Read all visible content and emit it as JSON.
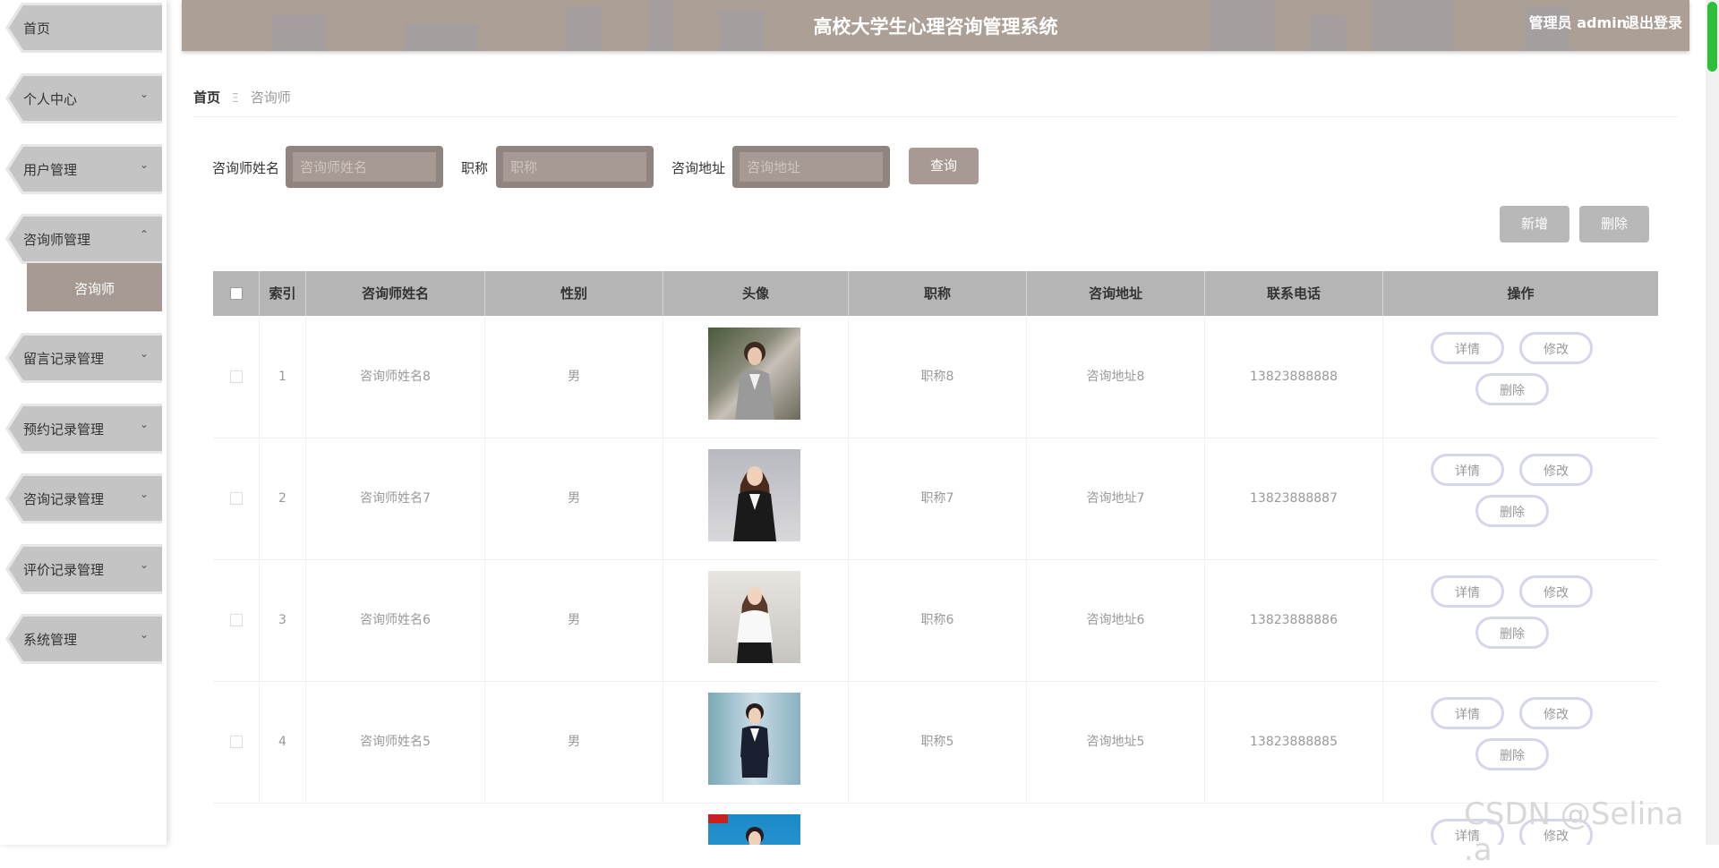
{
  "sidebar": {
    "items": [
      {
        "label": "首页",
        "arrow": ""
      },
      {
        "label": "个人中心",
        "arrow": "⌄"
      },
      {
        "label": "用户管理",
        "arrow": "⌄"
      },
      {
        "label": "咨询师管理",
        "arrow": "⌃"
      },
      {
        "label": "留言记录管理",
        "arrow": "⌄"
      },
      {
        "label": "预约记录管理",
        "arrow": "⌄"
      },
      {
        "label": "咨询记录管理",
        "arrow": "⌄"
      },
      {
        "label": "评价记录管理",
        "arrow": "⌄"
      },
      {
        "label": "系统管理",
        "arrow": "⌄"
      }
    ],
    "sub_item": "咨询师"
  },
  "header": {
    "title": "高校大学生心理咨询管理系统",
    "user": "管理员 admin",
    "logout": "退出登录"
  },
  "breadcrumb": {
    "home": "首页",
    "separator": "Ξ",
    "current": "咨询师"
  },
  "search": {
    "name_label": "咨询师姓名",
    "name_placeholder": "咨询师姓名",
    "title_label": "职称",
    "title_placeholder": "职称",
    "addr_label": "咨询地址",
    "addr_placeholder": "咨询地址",
    "query_button": "查询"
  },
  "actions": {
    "add": "新增",
    "delete": "删除"
  },
  "table": {
    "headers": [
      "索引",
      "咨询师姓名",
      "性别",
      "头像",
      "职称",
      "咨询地址",
      "联系电话",
      "操作"
    ],
    "rows": [
      {
        "index": "1",
        "name": "咨询师姓名8",
        "gender": "男",
        "title": "职称8",
        "address": "咨询地址8",
        "phone": "13823888888"
      },
      {
        "index": "2",
        "name": "咨询师姓名7",
        "gender": "男",
        "title": "职称7",
        "address": "咨询地址7",
        "phone": "13823888887"
      },
      {
        "index": "3",
        "name": "咨询师姓名6",
        "gender": "男",
        "title": "职称6",
        "address": "咨询地址6",
        "phone": "13823888886"
      },
      {
        "index": "4",
        "name": "咨询师姓名5",
        "gender": "男",
        "title": "职称5",
        "address": "咨询地址5",
        "phone": "13823888885"
      },
      {
        "index": "",
        "name": "",
        "gender": "",
        "title": "",
        "address": "",
        "phone": ""
      }
    ],
    "op_detail": "详情",
    "op_edit": "修改",
    "op_delete": "删除"
  },
  "watermark": "CSDN @Selina .a",
  "colors": {
    "header_bg": "#ab9f96",
    "sidebar_item": "#c4c4c4",
    "active_sub": "#a69a93",
    "table_header": "#b5b5b5",
    "op_border": "#d4d6ee"
  }
}
